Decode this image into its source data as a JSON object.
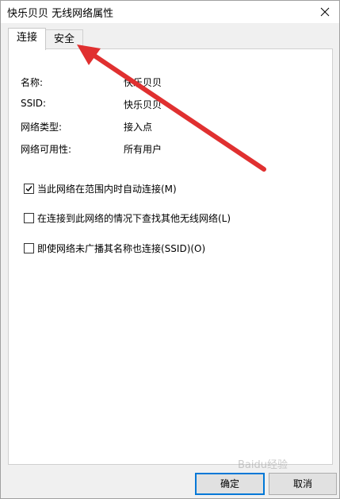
{
  "window": {
    "title": "快乐贝贝 无线网络属性",
    "close_icon": "close-icon"
  },
  "tabs": [
    {
      "label": "连接",
      "active": true
    },
    {
      "label": "安全",
      "active": false
    }
  ],
  "properties": [
    {
      "label": "名称:",
      "value": "快乐贝贝"
    },
    {
      "label": "SSID:",
      "value": "快乐贝贝"
    },
    {
      "label": "网络类型:",
      "value": "接入点"
    },
    {
      "label": "网络可用性:",
      "value": "所有用户"
    }
  ],
  "options": [
    {
      "label": "当此网络在范围内时自动连接(M)",
      "checked": true
    },
    {
      "label": "在连接到此网络的情况下查找其他无线网络(L)",
      "checked": false
    },
    {
      "label": "即使网络未广播其名称也连接(SSID)(O)",
      "checked": false
    }
  ],
  "buttons": {
    "ok_label": "确定",
    "cancel_label": "取消"
  },
  "watermark": "Baidu经验",
  "colors": {
    "arrow": "#e03030",
    "ok_border": "#0078d7"
  }
}
